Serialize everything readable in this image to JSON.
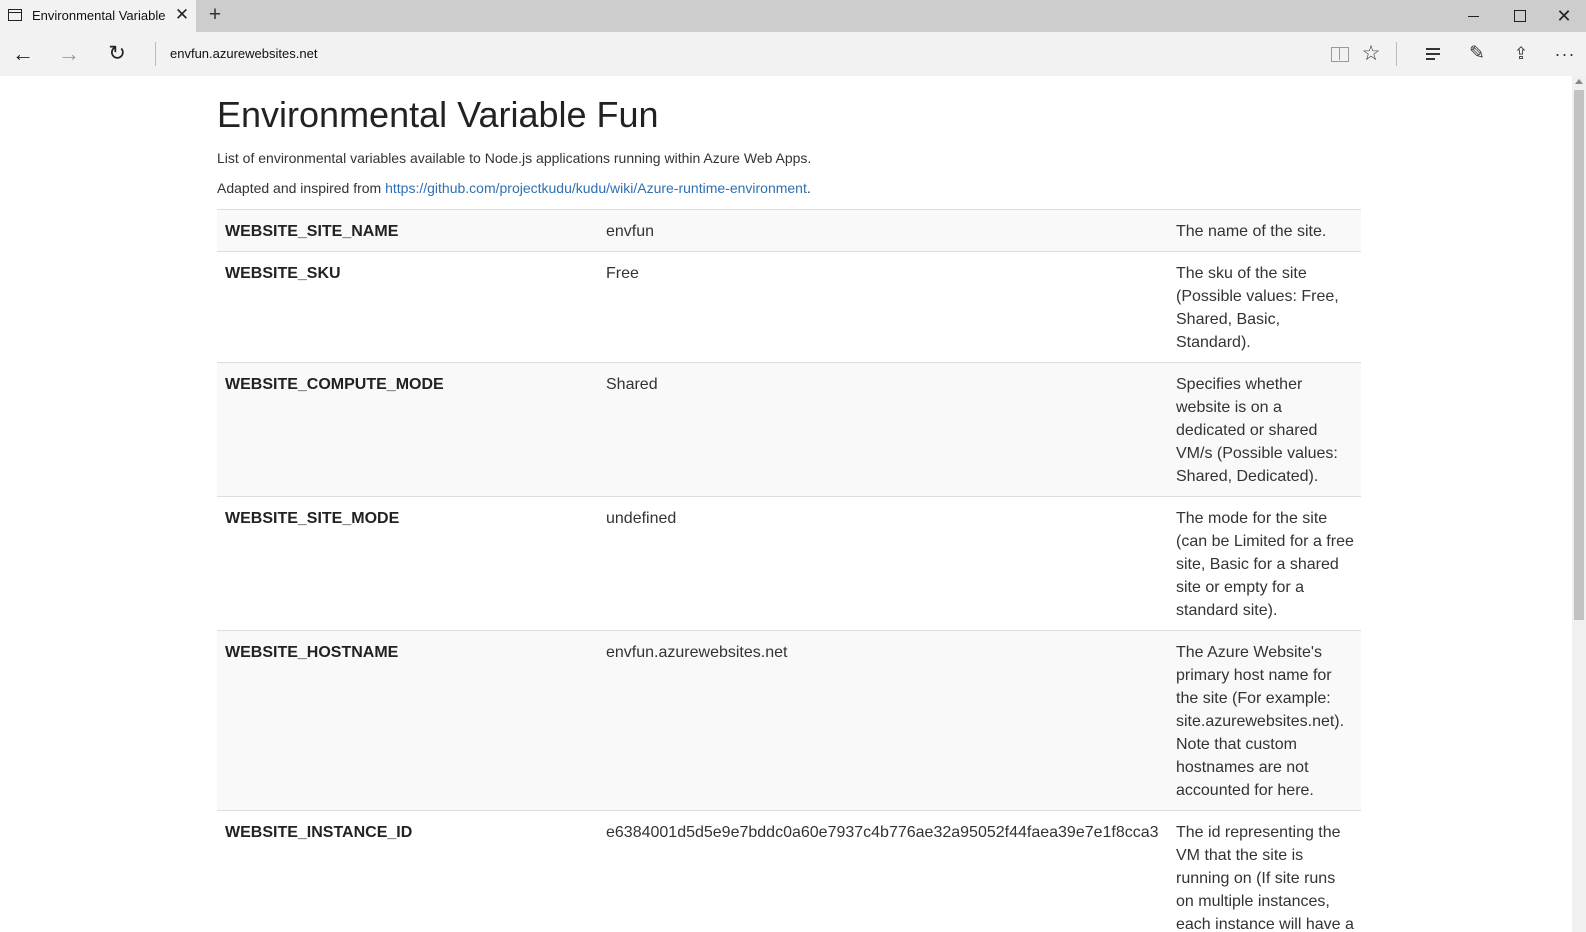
{
  "browser": {
    "tab_title": "Environmental Variable",
    "new_tab_symbol": "+",
    "url": "envfun.azurewebsites.net"
  },
  "page": {
    "title": "Environmental Variable Fun",
    "intro": "List of environmental variables available to Node.js applications running within Azure Web Apps.",
    "adapted_prefix": "Adapted and inspired from ",
    "adapted_link": "https://github.com/projectkudu/kudu/wiki/Azure-runtime-environment",
    "adapted_suffix": ".",
    "rows": [
      {
        "name": "WEBSITE_SITE_NAME",
        "value": "envfun",
        "description": "The name of the site."
      },
      {
        "name": "WEBSITE_SKU",
        "value": "Free",
        "description": "The sku of the site (Possible values: Free, Shared, Basic, Standard)."
      },
      {
        "name": "WEBSITE_COMPUTE_MODE",
        "value": "Shared",
        "description": "Specifies whether website is on a dedicated or shared VM/s (Possible values: Shared, Dedicated)."
      },
      {
        "name": "WEBSITE_SITE_MODE",
        "value": "undefined",
        "description": "The mode for the site (can be Limited for a free site, Basic for a shared site or empty for a standard site)."
      },
      {
        "name": "WEBSITE_HOSTNAME",
        "value": "envfun.azurewebsites.net",
        "description": "The Azure Website's primary host name for the site (For example: site.azurewebsites.net). Note that custom hostnames are not accounted for here."
      },
      {
        "name": "WEBSITE_INSTANCE_ID",
        "value": "e6384001d5d5e9e7bddc0a60e7937c4b776ae32a95052f44faea39e7e1f8cca3",
        "description": "The id representing the VM that the site is running on (If site runs on multiple instances, each instance will have a different id)."
      }
    ]
  },
  "icons": {
    "tab_page": "page-icon",
    "tab_close": "close-icon",
    "back": "back-arrow-icon",
    "forward": "forward-arrow-icon",
    "refresh": "refresh-icon",
    "reading_view": "reading-view-icon",
    "favorite": "star-icon",
    "hub": "hub-icon",
    "web_note": "web-note-icon",
    "share": "share-icon",
    "more": "more-icon"
  },
  "colors": {
    "link": "#2f6fb3",
    "tab_bar": "#cdcdcd",
    "toolbar": "#f2f2f2",
    "row_stripe": "#f9f9f9"
  }
}
